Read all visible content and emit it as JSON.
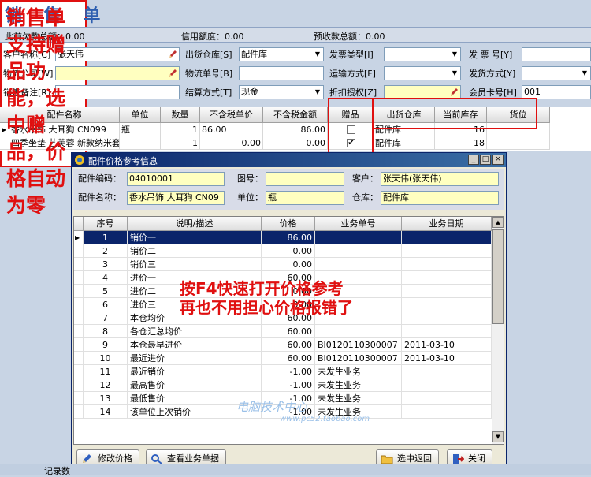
{
  "title": "销 售 单",
  "summary": {
    "prev_debt": "此前欠款总额：0.00",
    "credit": "信用额度：0.00",
    "prepay": "预收款总额：0.00"
  },
  "form": {
    "customer_label": "客户名称[C]",
    "customer_value": "张天伟",
    "warehouse_label": "出货仓库[S]",
    "warehouse_value": "配件库",
    "invoice_type_label": "发票类型[I]",
    "invoice_type_value": "",
    "invoice_no_label": "发 票 号[Y]",
    "invoice_no_value": "",
    "logistics_label": "物流公司[W]",
    "logistics_value": "",
    "logistics_no_label": "物流单号[B]",
    "logistics_no_value": "",
    "transport_label": "运输方式[F]",
    "transport_value": "",
    "ship_method_label": "发货方式[Y]",
    "ship_method_value": "",
    "remark_label": "销售备注[R]",
    "remark_value": "",
    "settle_label": "结算方式[T]",
    "settle_value": "现金",
    "discount_label": "折扣授权[Z]",
    "discount_value": "",
    "member_label": "会员卡号[H]",
    "member_value": "001"
  },
  "main_grid": {
    "headers": [
      "配件名称",
      "单位",
      "数量",
      "不含税单价",
      "不含税金额",
      "赠品",
      "出货仓库",
      "当前库存",
      "货位"
    ],
    "rows": [
      {
        "name": "香水吊饰 大耳狗 CN099",
        "unit": "瓶",
        "qty": "1",
        "price": "86.00",
        "amount": "86.00",
        "gift": false,
        "warehouse": "配件库",
        "stock": "16",
        "loc": ""
      },
      {
        "name": "四季坐垫 艺芙蓉 新款纳米套",
        "unit": "",
        "qty": "1",
        "price": "0.00",
        "amount": "0.00",
        "gift": true,
        "warehouse": "配件库",
        "stock": "18",
        "loc": ""
      }
    ]
  },
  "dialog": {
    "title": "配件价格参考信息",
    "code_label": "配件编码：",
    "code_value": "04010001",
    "drawing_label": "图号：",
    "drawing_value": "",
    "customer_label": "客户：",
    "customer_value": "张天伟(张天伟)",
    "name_label": "配件名称：",
    "name_value": "香水吊饰 大耳狗 CN09",
    "unit_label": "单位：",
    "unit_value": "瓶",
    "warehouse_label": "仓库：",
    "warehouse_value": "配件库",
    "headers": [
      "序号",
      "说明/描述",
      "价格",
      "业务单号",
      "业务日期"
    ],
    "rows": [
      [
        "1",
        "销价一",
        "86.00",
        "",
        ""
      ],
      [
        "2",
        "销价二",
        "0.00",
        "",
        ""
      ],
      [
        "3",
        "销价三",
        "0.00",
        "",
        ""
      ],
      [
        "4",
        "进价一",
        "60.00",
        "",
        ""
      ],
      [
        "5",
        "进价二",
        "0.00",
        "",
        ""
      ],
      [
        "6",
        "进价三",
        "0.00",
        "",
        ""
      ],
      [
        "7",
        "本仓均价",
        "60.00",
        "",
        ""
      ],
      [
        "8",
        "各仓汇总均价",
        "60.00",
        "",
        ""
      ],
      [
        "9",
        "本仓最早进价",
        "60.00",
        "BI0120110300007",
        "2011-03-10"
      ],
      [
        "10",
        "最近进价",
        "60.00",
        "BI0120110300007",
        "2011-03-10"
      ],
      [
        "11",
        "最近销价",
        "-1.00",
        "未发生业务",
        ""
      ],
      [
        "12",
        "最高售价",
        "-1.00",
        "未发生业务",
        ""
      ],
      [
        "13",
        "最低售价",
        "-1.00",
        "未发生业务",
        ""
      ],
      [
        "14",
        "该单位上次销价",
        "-1.00",
        "未发生业务",
        ""
      ]
    ],
    "btn_modify": "修改价格",
    "btn_view": "查看业务单据",
    "btn_select": "选中返回",
    "btn_close": "关闭"
  },
  "annotations": {
    "f4_line1": "按F4快速打开价格参考",
    "f4_line2": "再也不用担心价格报错了",
    "right": "销售单支持赠品功能，选中赠品，价格自动为零"
  },
  "watermark": {
    "line1": "电脑技术中心",
    "line2": "www.pc52.taobao.com"
  },
  "bottom_label": "记录数",
  "colors": {
    "accent": "#2e5fb0",
    "annotation": "#e01010",
    "selection": "#0a246a"
  }
}
